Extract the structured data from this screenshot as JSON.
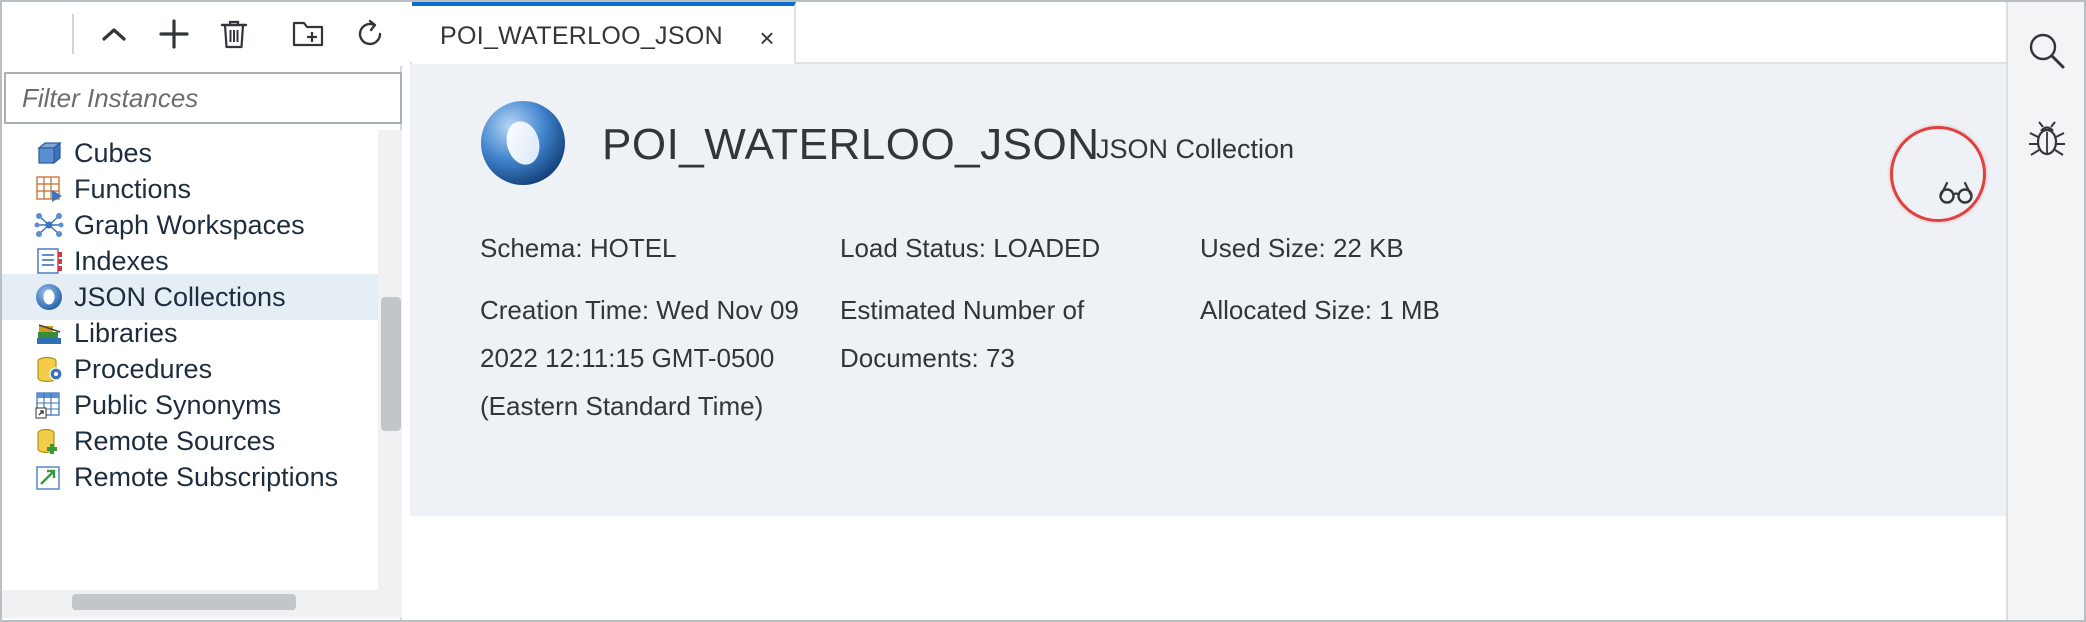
{
  "toolbar": {
    "collapse_icon": "chevron-up-icon",
    "add_icon": "plus-icon",
    "delete_icon": "trash-icon",
    "add_folder_icon": "folder-add-icon",
    "refresh_icon": "refresh-icon"
  },
  "filter": {
    "placeholder": "Filter Instances",
    "value": ""
  },
  "tree": {
    "items": [
      {
        "label": "Cubes",
        "icon": "cube-icon"
      },
      {
        "label": "Functions",
        "icon": "function-icon"
      },
      {
        "label": "Graph Workspaces",
        "icon": "graph-icon"
      },
      {
        "label": "Indexes",
        "icon": "index-icon"
      },
      {
        "label": "JSON Collections",
        "icon": "json-collection-icon",
        "selected": true
      },
      {
        "label": "Libraries",
        "icon": "library-icon"
      },
      {
        "label": "Procedures",
        "icon": "procedure-icon"
      },
      {
        "label": "Public Synonyms",
        "icon": "synonym-icon"
      },
      {
        "label": "Remote Sources",
        "icon": "remote-source-icon"
      },
      {
        "label": "Remote Subscriptions",
        "icon": "remote-subscription-icon"
      }
    ]
  },
  "tab": {
    "label": "POI_WATERLOO_JSON",
    "close": "×"
  },
  "object": {
    "title": "POI_WATERLOO_JSON",
    "subtitle": "JSON Collection",
    "schema": "Schema: HOTEL",
    "load_status": "Load Status: LOADED",
    "used_size": "Used Size: 22 KB",
    "creation_time": "Creation Time: Wed Nov 09 2022 12:11:15 GMT-0500 (Eastern Standard Time)",
    "estimated_docs": "Estimated Number of Documents: 73",
    "allocated_size": "Allocated Size: 1 MB"
  },
  "colors": {
    "accent": "#0a6ed1",
    "header_bg": "#eef1f5",
    "highlight_ring": "#e0403e",
    "selected_row": "#e5edf5"
  },
  "right_pane": {
    "search_icon": "search-icon",
    "debug_icon": "bug-icon"
  }
}
